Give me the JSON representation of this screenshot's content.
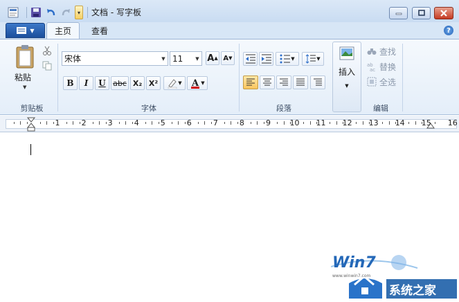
{
  "window": {
    "title": "文档 - 写字板"
  },
  "tabs": [
    {
      "label": "主页",
      "active": true
    },
    {
      "label": "查看",
      "active": false
    }
  ],
  "ribbon": {
    "clipboard": {
      "paste_label": "粘贴",
      "group_label": "剪贴板"
    },
    "font": {
      "family": "宋体",
      "size": "11",
      "bold": "B",
      "italic": "I",
      "underline": "U",
      "strikethrough": "abc",
      "subscript": "X₂",
      "superscript": "X²",
      "group_label": "字体"
    },
    "paragraph": {
      "group_label": "段落"
    },
    "insert": {
      "label": "插入"
    },
    "editing": {
      "find": "查找",
      "replace": "替换",
      "select_all": "全选",
      "group_label": "编辑"
    }
  },
  "ruler": {
    "numbers": [
      "1",
      "2",
      "3",
      "4",
      "5",
      "6",
      "7",
      "8",
      "9",
      "10",
      "11",
      "12",
      "13",
      "14",
      "15",
      "16"
    ]
  },
  "watermark": {
    "brand": "Win7",
    "site_name": "系统之家",
    "url": "www.winwin7.com"
  },
  "colors": {
    "accent": "#1b4f9c",
    "highlight": "#f9c55e",
    "text_color_bar": "#d00000"
  }
}
